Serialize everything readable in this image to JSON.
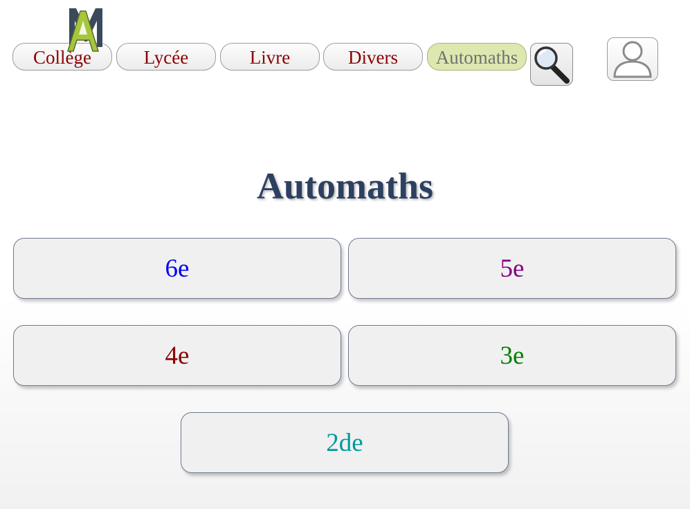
{
  "nav": {
    "tabs": [
      {
        "label": "Collège"
      },
      {
        "label": "Lycée"
      },
      {
        "label": "Livre"
      },
      {
        "label": "Divers"
      },
      {
        "label": "Automaths",
        "active": true
      }
    ],
    "search_icon": "magnifier-icon",
    "user_icon": "user-icon",
    "logo_icon": "site-logo-icon"
  },
  "page": {
    "title": "Automaths"
  },
  "levels": [
    {
      "label": "6e",
      "color": "#0000ee"
    },
    {
      "label": "5e",
      "color": "#800080"
    },
    {
      "label": "4e",
      "color": "#8b0000"
    },
    {
      "label": "3e",
      "color": "#008000"
    },
    {
      "label": "2de",
      "color": "#009999"
    }
  ],
  "colors": {
    "tab_text": "#8b0000",
    "tab_active_bg": "#dde8b0",
    "title": "#2d4060"
  }
}
